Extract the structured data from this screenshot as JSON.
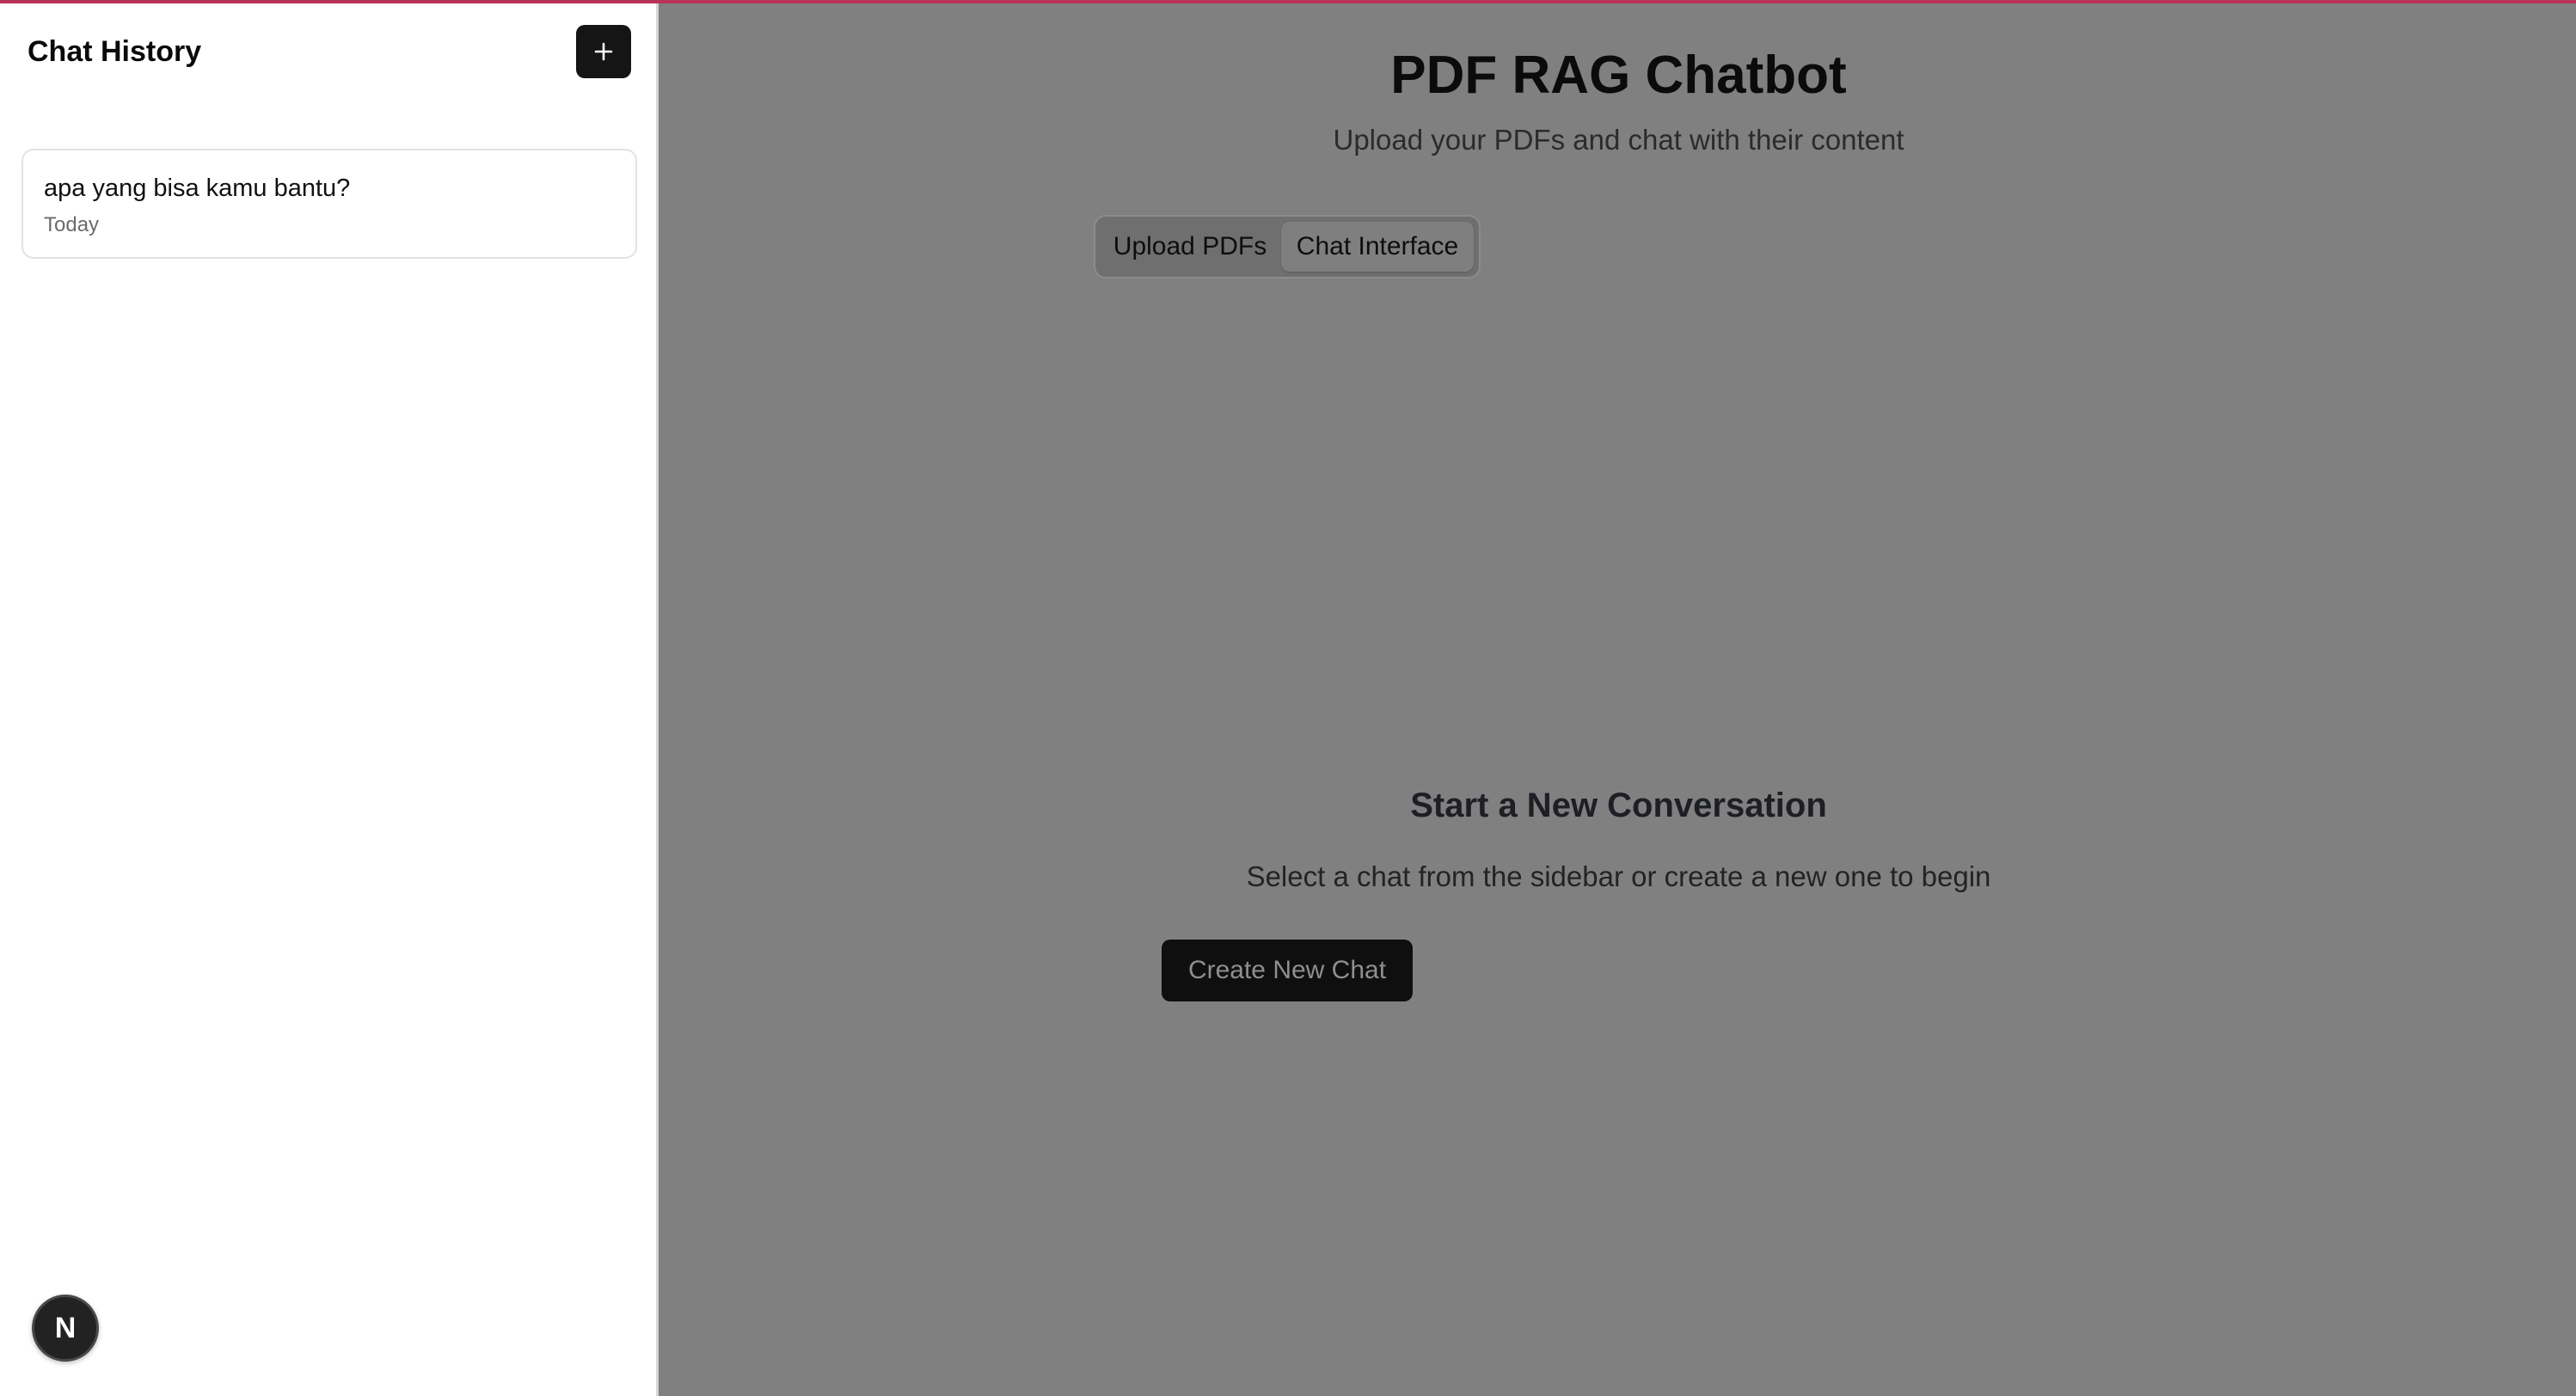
{
  "sidebar": {
    "title": "Chat History",
    "new_chat_icon": "plus-icon",
    "chats": [
      {
        "title": "apa yang bisa kamu bantu?",
        "date": "Today"
      }
    ],
    "avatar_letter": "N"
  },
  "main": {
    "title": "PDF RAG Chatbot",
    "subtitle": "Upload your PDFs and chat with their content",
    "tabs": [
      {
        "label": "Upload PDFs",
        "active": false
      },
      {
        "label": "Chat Interface",
        "active": true
      }
    ],
    "empty_state": {
      "heading": "Start a New Conversation",
      "text": "Select a chat from the sidebar or create a new one to begin",
      "button_label": "Create New Chat"
    }
  },
  "colors": {
    "accent_top_bar": "#b8325a",
    "overlay_background": "#808080",
    "button_dark": "#151515"
  }
}
